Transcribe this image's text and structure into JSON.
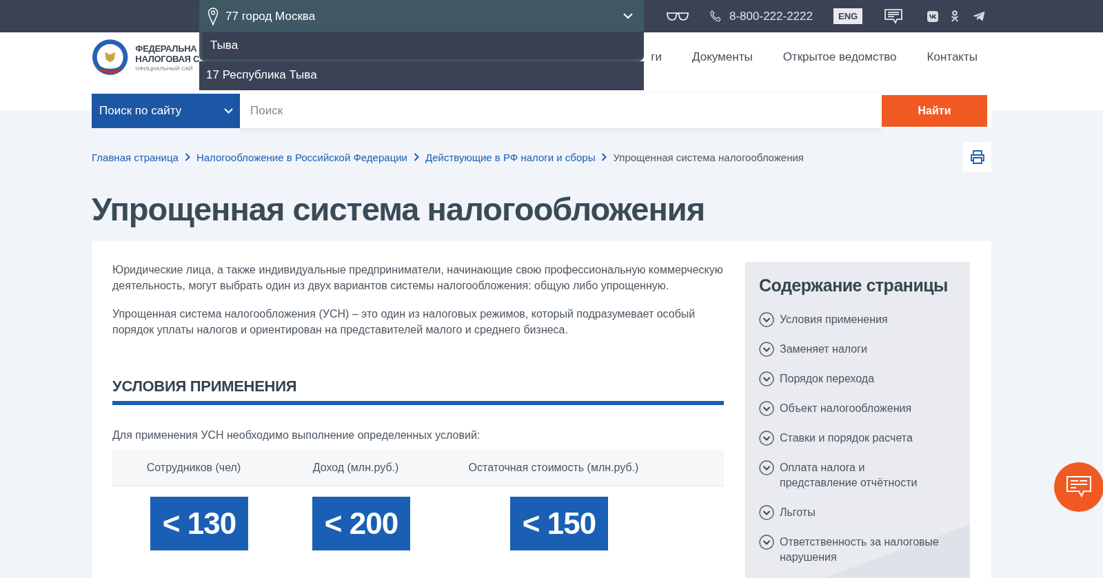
{
  "top_bar": {
    "region": "77 город Москва",
    "region_search": "Тыва",
    "region_options": [
      "17 Республика Тыва"
    ],
    "phone": "8-800-222-2222",
    "language": "ENG"
  },
  "header": {
    "logo_lines": [
      "ФЕДЕРАЛЬНА",
      "НАЛОГОВАЯ С",
      "ОФИЦИАЛЬНЫЙ САЙ"
    ],
    "nav": [
      "ги",
      "Документы",
      "Открытое ведомство",
      "Контакты"
    ]
  },
  "search": {
    "scope": "Поиск по сайту",
    "placeholder": "Поиск",
    "button": "Найти"
  },
  "breadcrumbs": [
    "Главная страница",
    "Налогообложение в Российской Федерации",
    "Действующие в РФ налоги и сборы",
    "Упрощенная система налогообложения"
  ],
  "title": "Упрощенная система налогообложения",
  "intro": [
    "Юридические лица, а также индивидуальные предприниматели, начинающие свою профессиональную коммерческую деятельность, могут выбрать один из двух вариантов системы налогообложения: общую либо упрощенную.",
    "Упрощенная система налогообложения (УСН) – это один из налоговых режимов, который подразумевает особый порядок уплаты налогов и ориентирован на представителей малого и среднего бизнеса."
  ],
  "section": {
    "heading": "УСЛОВИЯ ПРИМЕНЕНИЯ",
    "lead": "Для применения УСН необходимо выполнение определенных условий:",
    "table": {
      "columns": [
        "Сотрудников (чел)",
        "Доход (млн.руб.)",
        "Остаточная стоимость (млн.руб.)"
      ],
      "values": [
        "< 130",
        "< 200",
        "< 150"
      ]
    }
  },
  "toc": {
    "title": "Содержание страницы",
    "items": [
      "Условия применения",
      "Заменяет налоги",
      "Порядок перехода",
      "Объект налогообложения",
      "Ставки и порядок расчета",
      "Оплата налога и представление отчётности",
      "Льготы",
      "Ответственность за налоговые нарушения"
    ]
  }
}
